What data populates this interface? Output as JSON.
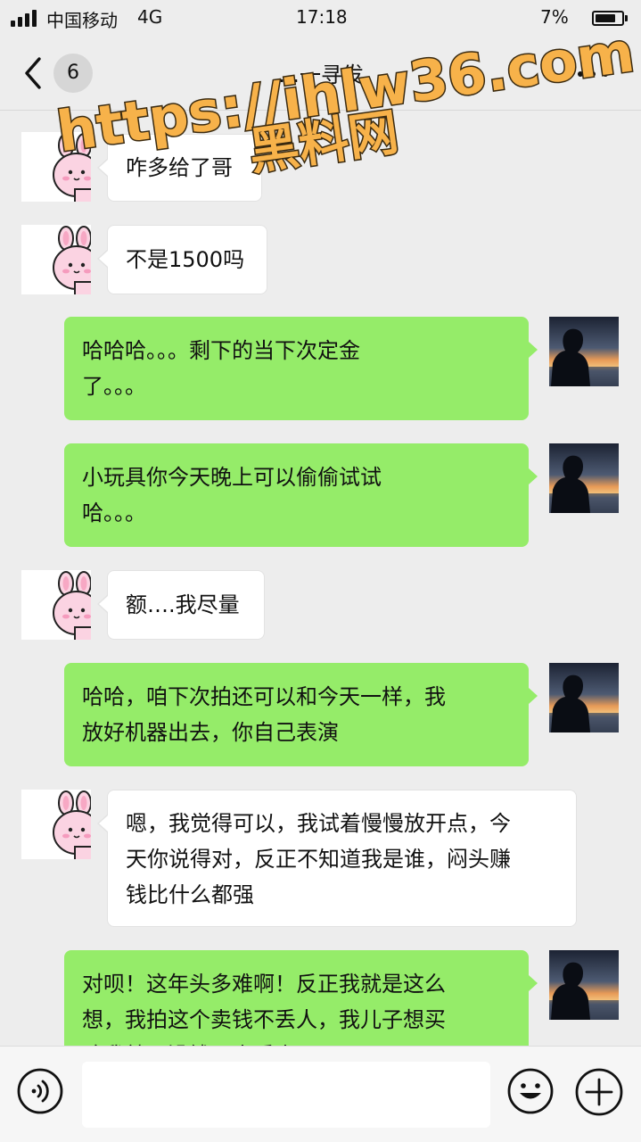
{
  "status_bar": {
    "carrier": "中国移动",
    "network": "4G",
    "time": "17:18",
    "battery_percent_text": "7%",
    "battery_level": 0.8,
    "signal_bars": 4
  },
  "nav": {
    "back_icon": "chevron-left-icon",
    "unread_count": "6",
    "title": "…一寻发",
    "more_icon": "more-dots-icon"
  },
  "watermark": {
    "line1": "https://ihlw36.com",
    "line2": "黑料网",
    "color": "#f7b24a",
    "outline": "#3a2a10"
  },
  "messages": [
    {
      "direction": "in",
      "avatar": "pink-bunny-avatar",
      "lines": [
        "咋多给了哥"
      ]
    },
    {
      "direction": "in",
      "avatar": "pink-bunny-avatar",
      "lines": [
        "不是1500吗"
      ]
    },
    {
      "direction": "out",
      "avatar": "sunset-silhouette-avatar",
      "lines": [
        "哈哈哈。。。剩下的当下次定金",
        "了。。。"
      ]
    },
    {
      "direction": "out",
      "avatar": "sunset-silhouette-avatar",
      "lines": [
        "小玩具你今天晚上可以偷偷试试",
        "哈。。。"
      ]
    },
    {
      "direction": "in",
      "avatar": "pink-bunny-avatar",
      "lines": [
        "额….我尽量"
      ]
    },
    {
      "direction": "out",
      "avatar": "sunset-silhouette-avatar",
      "lines": [
        "哈哈，咱下次拍还可以和今天一样，我",
        "放好机器出去，你自己表演"
      ]
    },
    {
      "direction": "in",
      "avatar": "pink-bunny-avatar",
      "lines": [
        "嗯，我觉得可以，我试着慢慢放开点，今",
        "天你说得对，反正不知道我是谁，闷头赚",
        "钱比什么都强"
      ]
    },
    {
      "direction": "out",
      "avatar": "sunset-silhouette-avatar",
      "lines": [
        "对呗！这年头多难啊！反正我就是这么",
        "想，我拍这个卖钱不丢人，我儿子想买",
        "啥我就用没钱，人丢人"
      ]
    }
  ],
  "input_bar": {
    "voice_icon": "voice-icon",
    "input_value": "",
    "emoji_icon": "emoji-icon",
    "plus_icon": "plus-icon"
  },
  "colors": {
    "background": "#ededed",
    "incoming_bubble": "#ffffff",
    "outgoing_bubble": "#95ec69",
    "text": "#111111"
  }
}
